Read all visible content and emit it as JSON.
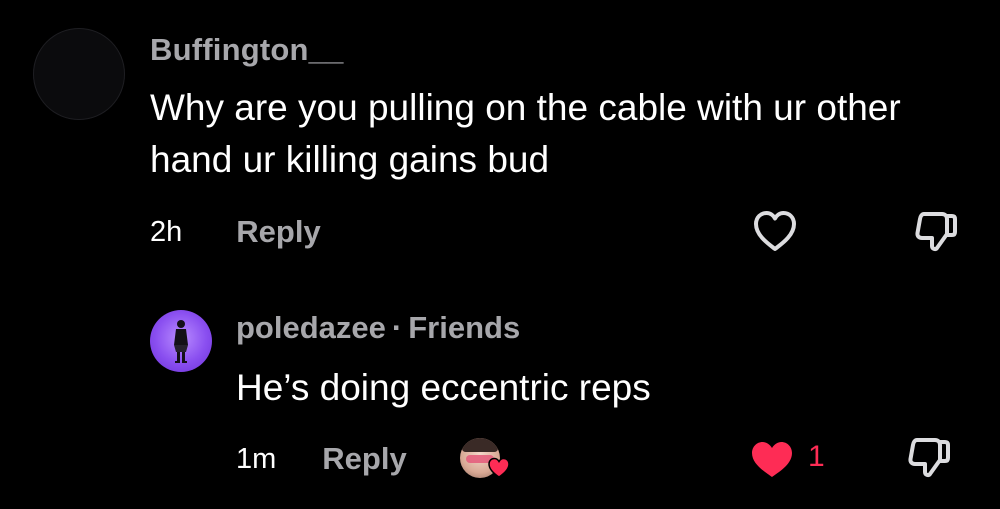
{
  "comments": [
    {
      "username": "Buffington__",
      "text": "Why are you pulling on the cable with ur other hand ur killing gains bud",
      "time": "2h",
      "reply_label": "Reply",
      "liked": false,
      "like_icon": "heart-outline-icon",
      "dislike_icon": "thumbs-down-icon"
    },
    {
      "username": "poledazee",
      "separator": "·",
      "relation": "Friends",
      "text": "He’s doing eccentric reps",
      "time": "1m",
      "reply_label": "Reply",
      "liked": true,
      "like_count": "1",
      "like_icon": "heart-filled-icon",
      "dislike_icon": "thumbs-down-icon",
      "liked_by_creator_icon": "creator-liked-avatar-icon"
    }
  ],
  "colors": {
    "background": "#000000",
    "text_primary": "#ffffff",
    "text_secondary": "#a7a7ab",
    "like_accent": "#fe2c55",
    "avatar_purple": "#8a4ff0"
  }
}
